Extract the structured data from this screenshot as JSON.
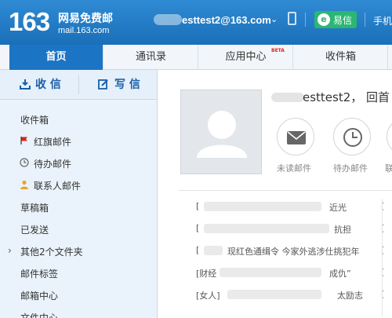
{
  "header": {
    "logo_number": "163",
    "logo_name": "网易免费邮",
    "logo_url": "mail.163.com",
    "account": "esttest2@163.com",
    "yixin_label": "易信",
    "mobile_label": "手机"
  },
  "tabs": [
    {
      "label": "首页"
    },
    {
      "label": "通讯录"
    },
    {
      "label": "应用中心",
      "badge": "BETA"
    },
    {
      "label": "收件箱"
    }
  ],
  "sidebar": {
    "receive_label": "收 信",
    "write_label": "写 信",
    "items": [
      {
        "label": "收件箱"
      },
      {
        "label": "红旗邮件"
      },
      {
        "label": "待办邮件"
      },
      {
        "label": "联系人邮件"
      },
      {
        "label": "草稿箱"
      },
      {
        "label": "已发送"
      },
      {
        "label": "其他2个文件夹"
      },
      {
        "label": "邮件标签"
      },
      {
        "label": "邮箱中心"
      },
      {
        "label": "文件中心"
      }
    ]
  },
  "main": {
    "greeting": "esttest2， 回首",
    "quick_actions": [
      {
        "label": "未读邮件"
      },
      {
        "label": "待办邮件"
      },
      {
        "label": "联"
      }
    ],
    "news": [
      {
        "prefix": "[",
        "tail": "",
        "right": "近光",
        "right2": "[ "
      },
      {
        "prefix": "[",
        "tail": "",
        "right": "抗担",
        "right2": "[ "
      },
      {
        "prefix": "[",
        "tail": "现红色通缉令 今家外逃涉仕挑犯年",
        "right": "",
        "right2": "[ "
      },
      {
        "prefix": "[财经",
        "tail": "",
        "right": "成仇”",
        "right2": "[ "
      },
      {
        "prefix": "[女人]",
        "tail": "",
        "right": "太励志",
        "right2": "[ "
      }
    ]
  },
  "colors": {
    "header": "#1a6fb8",
    "active_tab": "#1b74c4",
    "sidebar_bg": "#eaf3fb",
    "yixin_green": "#2bb673",
    "flag_red": "#d9251c",
    "contact_orange": "#f0a030"
  }
}
